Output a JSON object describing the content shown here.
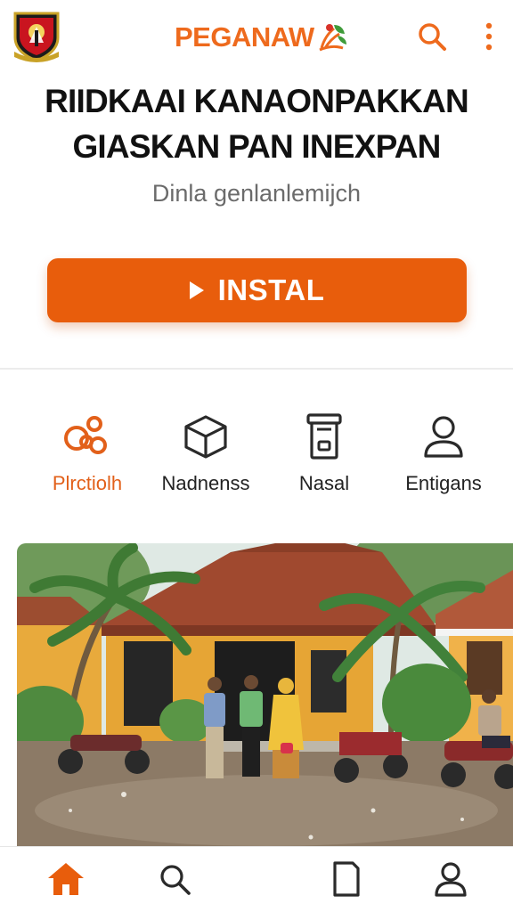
{
  "header": {
    "brand_name": "PEGANAW",
    "emblem_icon": "shield-emblem-icon",
    "brand_mark_icon": "leaf-rice-icon",
    "search_icon": "search-icon",
    "menu_icon": "more-vertical-icon"
  },
  "hero": {
    "title_line1": "RIIDKAAI KANAONPAKKAN",
    "title_line2": "GIASKAN PAN INEXPAN",
    "subtitle": "Dinla genlanlemijch",
    "install_label": "INSTAL",
    "install_icon": "play-icon"
  },
  "categories": [
    {
      "label": "Plrctiolh",
      "icon": "circles-icon",
      "active": true
    },
    {
      "label": "Nadnenss",
      "icon": "cube-icon",
      "active": false
    },
    {
      "label": "Nasal",
      "icon": "container-icon",
      "active": false
    },
    {
      "label": "Entigans",
      "icon": "user-icon",
      "active": false
    }
  ],
  "photo": {
    "subject": "community-house-photo"
  },
  "bottom_nav": [
    {
      "icon": "home-icon",
      "active": true
    },
    {
      "icon": "search-icon",
      "active": false
    },
    {
      "icon": "document-icon",
      "active": false
    },
    {
      "icon": "profile-icon",
      "active": false
    }
  ],
  "colors": {
    "accent": "#e85d0c",
    "brand": "#ee6a1d",
    "text": "#111111",
    "muted": "#6b6b6b"
  }
}
